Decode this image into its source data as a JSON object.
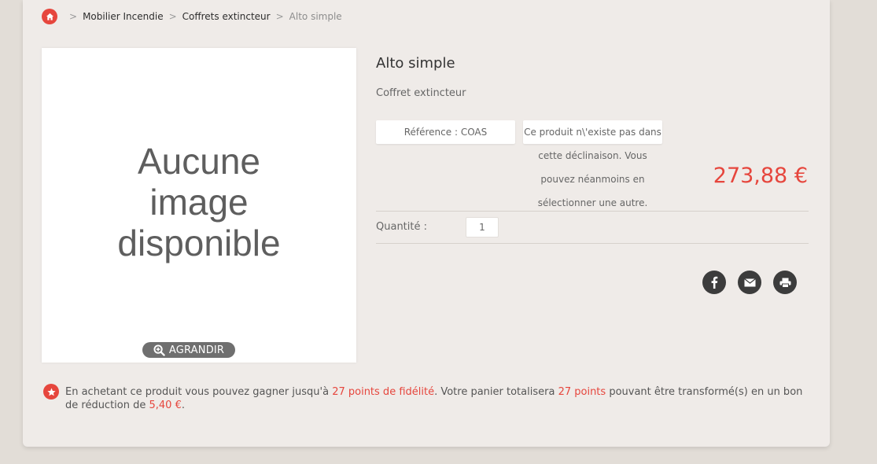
{
  "breadcrumb": {
    "items": [
      "Mobilier Incendie",
      "Coffrets extincteur"
    ],
    "current": "Alto simple",
    "separator": ">"
  },
  "image": {
    "placeholder_lines": [
      "Aucune",
      "image",
      "disponible"
    ],
    "zoom_label": "AGRANDIR"
  },
  "product": {
    "title": "Alto simple",
    "subtitle": "Coffret extincteur",
    "reference": "Référence : COAS",
    "availability_lines": [
      "Ce produit n\\'existe pas dans",
      "cette déclinaison. Vous",
      "pouvez néanmoins en",
      "sélectionner une autre."
    ],
    "price": "273,88 €",
    "quantity_label": "Quantité :",
    "quantity_value": "1"
  },
  "share": {
    "icons": [
      "facebook-icon",
      "email-icon",
      "print-icon"
    ]
  },
  "loyalty": {
    "part1": "En achetant ce produit vous pouvez gagner jusqu'à ",
    "points_text": "27 points de fidélité",
    "part2": ". Votre panier totalisera ",
    "total_points": "27 points",
    "part3": " pouvant être transformé(s) en un bon de réduction de ",
    "voucher": "5,40 €",
    "part4": "."
  },
  "colors": {
    "accent": "#e6463d",
    "background": "#efebe8",
    "page": "#e2ddd7"
  }
}
